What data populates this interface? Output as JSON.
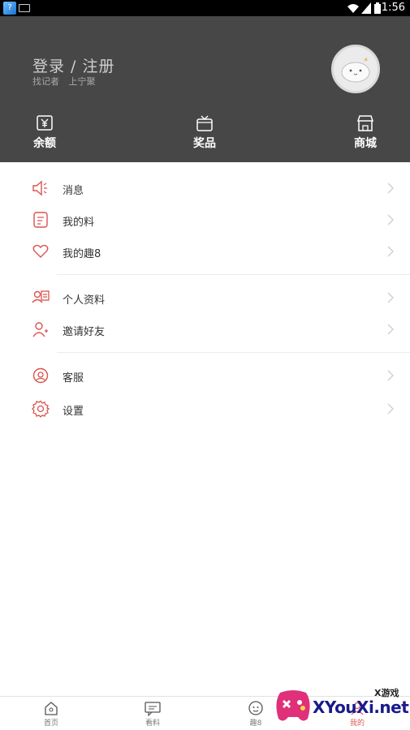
{
  "status_bar": {
    "time": "1:56",
    "icons": [
      "app-icon",
      "keyboard-icon",
      "wifi-icon",
      "signal-icon",
      "battery-icon"
    ]
  },
  "header": {
    "background": "#474747",
    "login_title": "登录 / 注册",
    "subtitle": "找记者   上宁聚",
    "quick_actions": [
      {
        "label": "余额",
        "icon": "yen-wallet-icon"
      },
      {
        "label": "奖品",
        "icon": "gift-box-icon"
      },
      {
        "label": "商城",
        "icon": "shop-icon"
      }
    ]
  },
  "menu": {
    "accent_color": "#d9534f",
    "groups": [
      [
        {
          "label": "消息",
          "icon": "speaker-icon"
        },
        {
          "label": "我的料",
          "icon": "note-icon"
        },
        {
          "label": "我的趣8",
          "icon": "heart-icon"
        }
      ],
      [
        {
          "label": "个人资料",
          "icon": "profile-card-icon"
        },
        {
          "label": "邀请好友",
          "icon": "person-add-icon"
        }
      ],
      [
        {
          "label": "客服",
          "icon": "customer-service-icon"
        },
        {
          "label": "设置",
          "icon": "gear-icon"
        }
      ]
    ]
  },
  "bottom_nav": {
    "items": [
      {
        "label": "首页",
        "icon": "home-icon"
      },
      {
        "label": "看料",
        "icon": "chat-icon"
      },
      {
        "label": "趣8",
        "icon": "face-icon"
      },
      {
        "label": "我的",
        "icon": "user-icon"
      }
    ]
  },
  "watermark": {
    "small": "X游戏",
    "text": "XYouXi.net"
  }
}
